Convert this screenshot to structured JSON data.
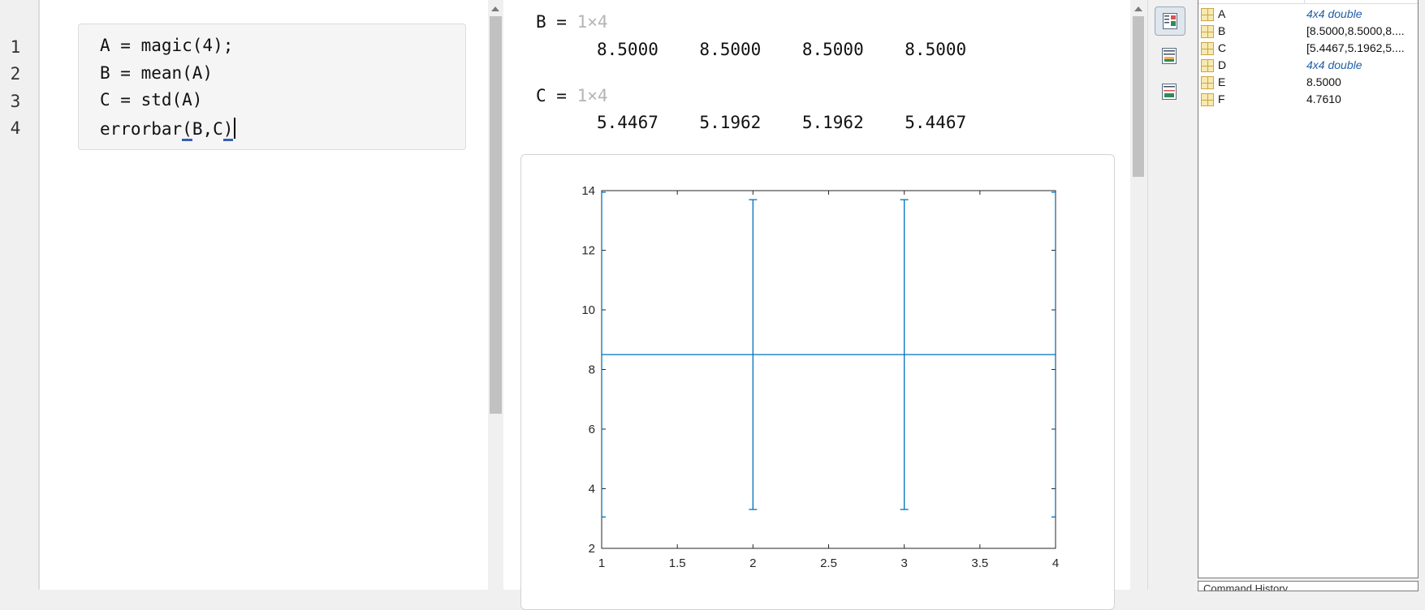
{
  "editor": {
    "line_numbers": [
      "1",
      "2",
      "3",
      "4"
    ],
    "code": {
      "line1": "A = magic(4);",
      "line2": "B = mean(A)",
      "line3": "C = std(A)",
      "line4_prefix": "errorbar",
      "line4_paren_open": "(",
      "line4_mid": "B,C",
      "line4_paren_close": ")"
    }
  },
  "output": {
    "b_label": "B = ",
    "b_dim": "1×4",
    "b_values": "8.5000    8.5000    8.5000    8.5000",
    "c_label": "C = ",
    "c_dim": "1×4",
    "c_values": "5.4467    5.1962    5.1962    5.4467"
  },
  "chart_data": {
    "type": "errorbar",
    "x": [
      1,
      2,
      3,
      4
    ],
    "y": [
      8.5,
      8.5,
      8.5,
      8.5
    ],
    "err": [
      5.4467,
      5.1962,
      5.1962,
      5.4467
    ],
    "xlim": [
      1,
      4
    ],
    "ylim": [
      2,
      14
    ],
    "xticks": [
      "1",
      "1.5",
      "2",
      "2.5",
      "3",
      "3.5",
      "4"
    ],
    "yticks": [
      "2",
      "4",
      "6",
      "8",
      "10",
      "12",
      "14"
    ],
    "color": "#0072bd",
    "grid": false
  },
  "workspace": {
    "variables": [
      {
        "name": "A",
        "value": "4x4 double",
        "italic": true
      },
      {
        "name": "B",
        "value": "[8.5000,8.5000,8....",
        "italic": false
      },
      {
        "name": "C",
        "value": "[5.4467,5.1962,5....",
        "italic": false
      },
      {
        "name": "D",
        "value": "4x4 double",
        "italic": true
      },
      {
        "name": "E",
        "value": "8.5000",
        "italic": false
      },
      {
        "name": "F",
        "value": "4.7610",
        "italic": false
      }
    ],
    "footer_label": "Command History"
  },
  "icons": {
    "toolbar": [
      "output-inline-icon",
      "output-right-icon",
      "hide-code-icon"
    ],
    "variable": "matrix-variable-icon"
  }
}
